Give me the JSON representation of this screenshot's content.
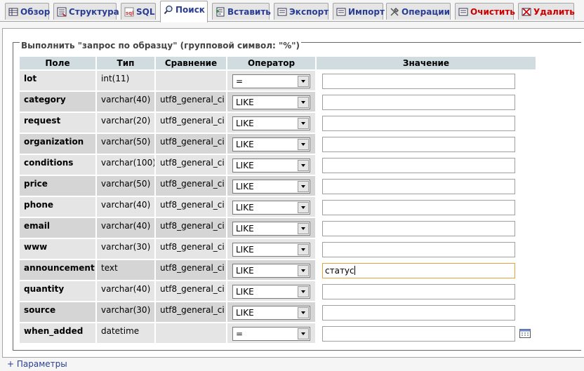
{
  "tabs": [
    {
      "label": "Обзор",
      "icon": "browse-icon"
    },
    {
      "label": "Структура",
      "icon": "structure-icon"
    },
    {
      "label": "SQL",
      "icon": "sql-icon"
    },
    {
      "label": "Поиск",
      "icon": "search-icon",
      "active": true
    },
    {
      "label": "Вставить",
      "icon": "insert-icon"
    },
    {
      "label": "Экспорт",
      "icon": "export-icon"
    },
    {
      "label": "Импорт",
      "icon": "import-icon"
    },
    {
      "label": "Операции",
      "icon": "operations-icon"
    },
    {
      "label": "Очистить",
      "icon": "empty-icon",
      "danger": true
    },
    {
      "label": "Удалить",
      "icon": "drop-icon",
      "danger": true
    }
  ],
  "search": {
    "legend": "Выполнить \"запрос по образцу\" (групповой символ: \"%\")",
    "headers": {
      "field": "Поле",
      "type": "Тип",
      "collation": "Сравнение",
      "operator": "Оператор",
      "value": "Значение"
    },
    "rows": [
      {
        "field": "lot",
        "type": "int(11)",
        "collation": "",
        "operator": "=",
        "value": ""
      },
      {
        "field": "category",
        "type": "varchar(40)",
        "collation": "utf8_general_ci",
        "operator": "LIKE",
        "value": ""
      },
      {
        "field": "request",
        "type": "varchar(20)",
        "collation": "utf8_general_ci",
        "operator": "LIKE",
        "value": ""
      },
      {
        "field": "organization",
        "type": "varchar(50)",
        "collation": "utf8_general_ci",
        "operator": "LIKE",
        "value": ""
      },
      {
        "field": "conditions",
        "type": "varchar(100)",
        "collation": "utf8_general_ci",
        "operator": "LIKE",
        "value": ""
      },
      {
        "field": "price",
        "type": "varchar(50)",
        "collation": "utf8_general_ci",
        "operator": "LIKE",
        "value": ""
      },
      {
        "field": "phone",
        "type": "varchar(40)",
        "collation": "utf8_general_ci",
        "operator": "LIKE",
        "value": ""
      },
      {
        "field": "email",
        "type": "varchar(40)",
        "collation": "utf8_general_ci",
        "operator": "LIKE",
        "value": ""
      },
      {
        "field": "www",
        "type": "varchar(30)",
        "collation": "utf8_general_ci",
        "operator": "LIKE",
        "value": ""
      },
      {
        "field": "announcement",
        "type": "text",
        "collation": "utf8_general_ci",
        "operator": "LIKE",
        "value": "статус",
        "focused": true
      },
      {
        "field": "quantity",
        "type": "varchar(40)",
        "collation": "utf8_general_ci",
        "operator": "LIKE",
        "value": ""
      },
      {
        "field": "source",
        "type": "varchar(30)",
        "collation": "utf8_general_ci",
        "operator": "LIKE",
        "value": ""
      },
      {
        "field": "when_added",
        "type": "datetime",
        "collation": "",
        "operator": "=",
        "value": "",
        "calendar": true
      }
    ]
  },
  "options_link": "+ Параметры"
}
